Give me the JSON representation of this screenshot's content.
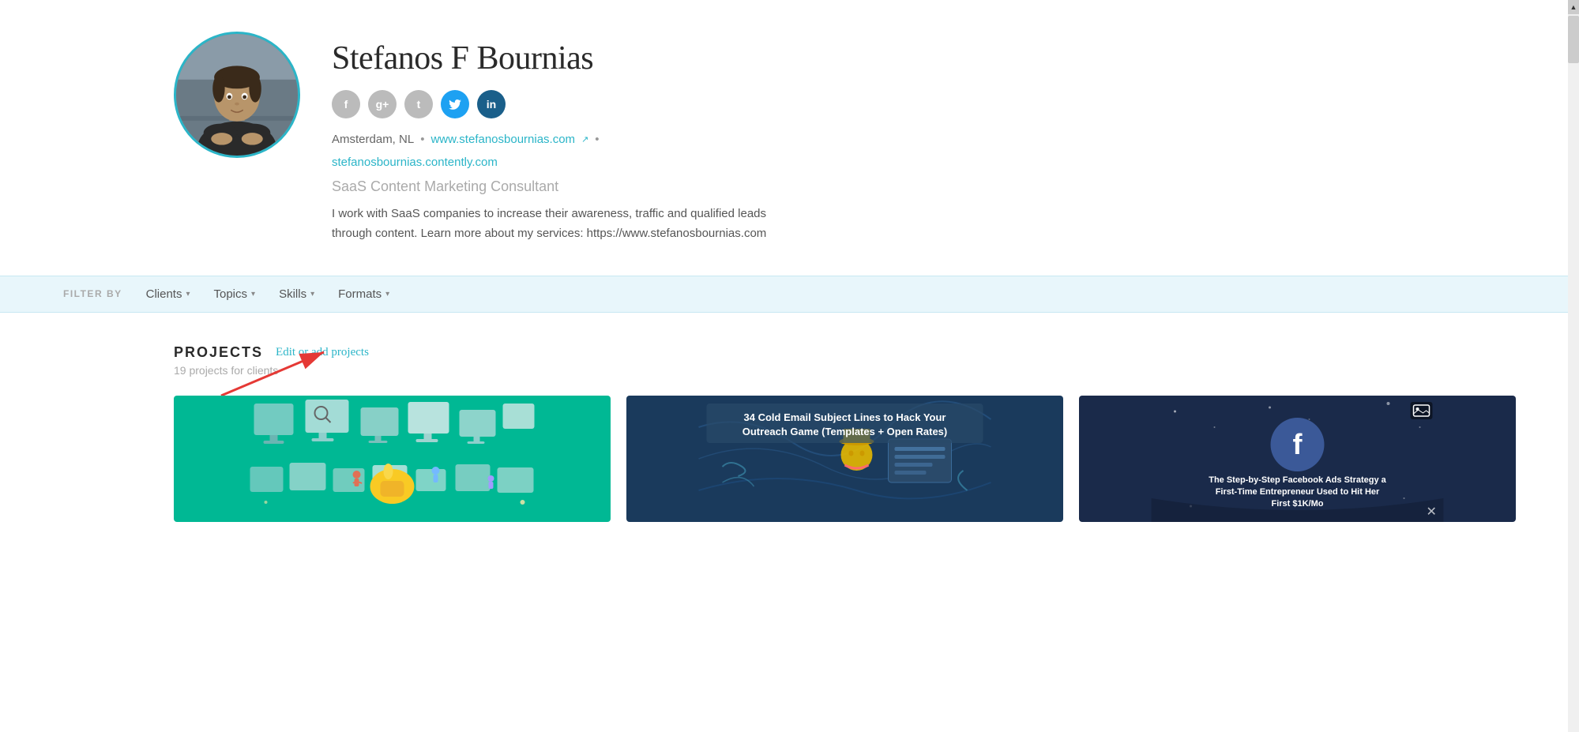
{
  "profile": {
    "name": "Stefanos F Bournias",
    "title": "SaaS Content Marketing Consultant",
    "bio": "I work with SaaS companies to increase their awareness, traffic and qualified leads through content. Learn more about my services: https://www.stefanosbournias.com",
    "location": "Amsterdam, NL",
    "website": "www.stefanosbournias.com",
    "website_url": "www.stefanosbournias.com",
    "contently_url": "stefanosbournias.contently.com",
    "social": {
      "facebook_label": "f",
      "googleplus_label": "g+",
      "tumblr_label": "t",
      "twitter_label": "t",
      "linkedin_label": "in"
    }
  },
  "filter_bar": {
    "label": "FILTER BY",
    "dropdowns": [
      {
        "label": "Clients"
      },
      {
        "label": "Topics"
      },
      {
        "label": "Skills"
      },
      {
        "label": "Formats"
      }
    ]
  },
  "projects": {
    "title": "PROJECTS",
    "edit_label": "Edit or add projects",
    "count_label": "19 projects for clients",
    "cards": [
      {
        "type": "illustration",
        "alt": "Green illustration card"
      },
      {
        "type": "cold_email",
        "title": "34 Cold Email Subject Lines to Hack Your Outreach Game (Templates + Open Rates)",
        "alt": "Cold email article"
      },
      {
        "type": "facebook",
        "title": "The Step-by-Step Facebook Ads Strategy a First-Time Entrepreneur Used to Hit Her First $1K/Mo",
        "alt": "Facebook ads article"
      }
    ]
  },
  "annotation": {
    "arrow_label": "Edit or add projects pointer"
  }
}
